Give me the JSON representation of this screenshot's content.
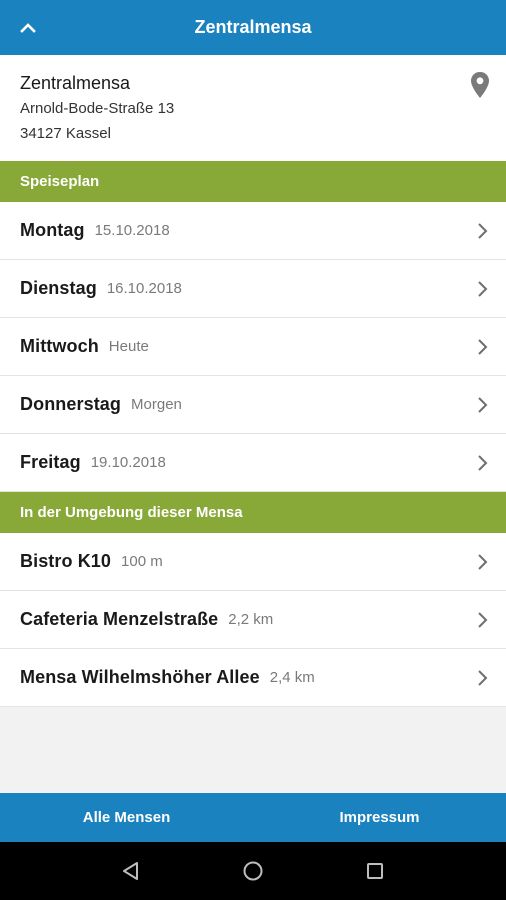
{
  "header": {
    "title": "Zentralmensa",
    "back_icon": "chevron-up-icon"
  },
  "info": {
    "name": "Zentralmensa",
    "street": "Arnold-Bode-Straße 13",
    "city": "34127 Kassel",
    "icon": "location-pin-icon"
  },
  "sections": {
    "plan": "Speiseplan",
    "nearby": "In der Umgebung dieser Mensa"
  },
  "days": [
    {
      "label": "Montag",
      "sub": "15.10.2018"
    },
    {
      "label": "Dienstag",
      "sub": "16.10.2018"
    },
    {
      "label": "Mittwoch",
      "sub": "Heute"
    },
    {
      "label": "Donnerstag",
      "sub": "Morgen"
    },
    {
      "label": "Freitag",
      "sub": "19.10.2018"
    }
  ],
  "nearby": [
    {
      "label": "Bistro K10",
      "sub": "100 m"
    },
    {
      "label": "Cafeteria Menzelstraße",
      "sub": "2,2 km"
    },
    {
      "label": "Mensa Wilhelmshöher Allee",
      "sub": "2,4 km"
    }
  ],
  "bottom": {
    "left": "Alle Mensen",
    "right": "Impressum"
  },
  "colors": {
    "primary": "#1a82be",
    "section": "#88a838"
  }
}
